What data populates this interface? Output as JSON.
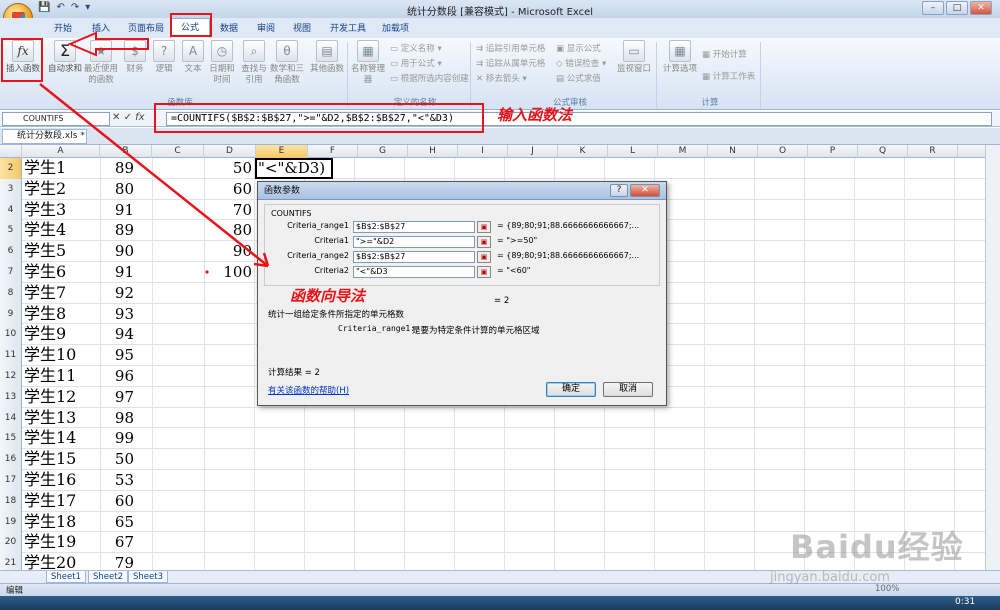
{
  "window": {
    "title": "统计分数段  [兼容模式] - Microsoft Excel",
    "min": "–",
    "max": "□",
    "close": "✕"
  },
  "tabs": [
    "开始",
    "插入",
    "页面布局",
    "公式",
    "数据",
    "审阅",
    "视图",
    "开发工具",
    "加载项"
  ],
  "active_tab": "公式",
  "ribbon": {
    "insert_function": "插入函数",
    "autosum": "自动求和",
    "recent": "最近使用的函数",
    "financial": "财务",
    "logical": "逻辑",
    "text": "文本",
    "datetime": "日期和时间",
    "lookup": "查找与引用",
    "math": "数学和三角函数",
    "more": "其他函数",
    "group_library": "函数库",
    "name_manager": "名称管理器",
    "define_name": "定义名称",
    "use_in_formula": "用于公式",
    "create_from_sel": "根据所选内容创建",
    "group_names": "定义的名称",
    "trace_precedents": "追踪引用单元格",
    "trace_dependents": "追踪从属单元格",
    "remove_arrows": "移去箭头",
    "show_formulas": "显示公式",
    "error_checking": "错误检查",
    "evaluate": "公式求值",
    "group_audit": "公式审核",
    "watch": "监视窗口",
    "calc_options": "计算选项",
    "calc_now": "开始计算",
    "calc_sheet": "计算工作表",
    "group_calc": "计算"
  },
  "formula_bar": {
    "name_box": "COUNTIFS",
    "formula": "=COUNTIFS($B$2:$B$27,\">=\"&D2,$B$2:$B$27,\"<\"&D3)"
  },
  "document_tab": "统计分数段.xls *",
  "columns": [
    "A",
    "B",
    "C",
    "D",
    "E",
    "F",
    "G",
    "H",
    "I",
    "J",
    "K",
    "L",
    "M",
    "N",
    "O",
    "P",
    "Q",
    "R"
  ],
  "rows": [
    {
      "n": "2",
      "a": "学生1",
      "b": "89",
      "d": "50"
    },
    {
      "n": "3",
      "a": "学生2",
      "b": "80",
      "d": "60"
    },
    {
      "n": "4",
      "a": "学生3",
      "b": "91",
      "d": "70"
    },
    {
      "n": "5",
      "a": "学生4",
      "b": "89",
      "d": "80"
    },
    {
      "n": "6",
      "a": "学生5",
      "b": "90",
      "d": "90"
    },
    {
      "n": "7",
      "a": "学生6",
      "b": "91",
      "d": "100"
    },
    {
      "n": "8",
      "a": "学生7",
      "b": "92",
      "d": ""
    },
    {
      "n": "9",
      "a": "学生8",
      "b": "93",
      "d": ""
    },
    {
      "n": "10",
      "a": "学生9",
      "b": "94",
      "d": ""
    },
    {
      "n": "11",
      "a": "学生10",
      "b": "95",
      "d": ""
    },
    {
      "n": "12",
      "a": "学生11",
      "b": "96",
      "d": ""
    },
    {
      "n": "13",
      "a": "学生12",
      "b": "97",
      "d": ""
    },
    {
      "n": "14",
      "a": "学生13",
      "b": "98",
      "d": ""
    },
    {
      "n": "15",
      "a": "学生14",
      "b": "99",
      "d": ""
    },
    {
      "n": "16",
      "a": "学生15",
      "b": "50",
      "d": ""
    },
    {
      "n": "17",
      "a": "学生16",
      "b": "53",
      "d": ""
    },
    {
      "n": "18",
      "a": "学生17",
      "b": "60",
      "d": ""
    },
    {
      "n": "19",
      "a": "学生18",
      "b": "65",
      "d": ""
    },
    {
      "n": "20",
      "a": "学生19",
      "b": "67",
      "d": ""
    },
    {
      "n": "21",
      "a": "学生20",
      "b": "79",
      "d": ""
    }
  ],
  "active_cell_text": "\"<\"&D3)",
  "dialog": {
    "title": "函数参数",
    "help_btn": "?",
    "close_btn": "✕",
    "function": "COUNTIFS",
    "args": [
      {
        "label": "Criteria_range1",
        "value": "$B$2:$B$27",
        "result": "= {89;80;91;88.6666666666667;..."
      },
      {
        "label": "Criteria1",
        "value": "\">=\"&D2",
        "result": "= \">=50\""
      },
      {
        "label": "Criteria_range2",
        "value": "$B$2:$B$27",
        "result": "= {89;80;91;88.6666666666667;..."
      },
      {
        "label": "Criteria2",
        "value": "\"<\"&D3",
        "result": "= \"<60\""
      }
    ],
    "formula_result_eq": "= 2",
    "description": "统计一组给定条件所指定的单元格数",
    "arg_desc_label": "Criteria_range1:",
    "arg_desc": "是要为特定条件计算的单元格区域",
    "calc_result": "计算结果 = 2",
    "help_link": "有关该函数的帮助(H)",
    "ok": "确定",
    "cancel": "取消"
  },
  "annotations": {
    "formula_input": "输入函数法",
    "wizard": "函数向导法"
  },
  "sheets": [
    "Sheet1",
    "Sheet2",
    "Sheet3"
  ],
  "status": {
    "mode": "编辑",
    "zoom": "100%"
  },
  "taskbar": {
    "clock": "0:31"
  },
  "watermark": {
    "text": "Baidu经验",
    "url": "jingyan.baidu.com"
  },
  "colors": {
    "annotation_red": "#e8141a",
    "ribbon_blue": "#15428b"
  }
}
